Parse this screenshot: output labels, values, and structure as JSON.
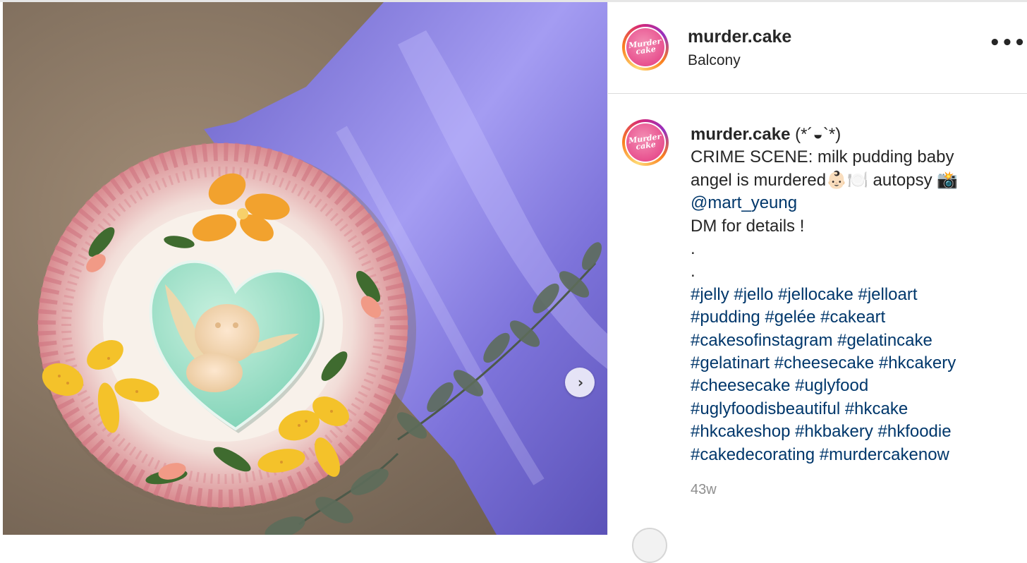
{
  "post": {
    "username": "murder.cake",
    "location": "Balcony",
    "avatar_text": "Murder cake",
    "more_label": "•••"
  },
  "caption": {
    "username": "murder.cake",
    "lines": [
      "(*´◒`*)",
      "CRIME SCENE: milk pudding baby",
      "angel is murdered👶🏻🍽️ autopsy 📸",
      "@mart_yeung",
      "DM for details !",
      ".",
      ".",
      "#jelly #jello #jellocake #jelloart",
      "#pudding #gelée #cakeart",
      "#cakesofinstagram #gelatincake",
      "#gelatinart #cheesecake #hkcakery",
      "#cheesecake #uglyfood",
      "#uglyfoodisbeautiful #hkcake",
      "#hkcakeshop #hkbakery #hkfoodie",
      "#cakedecorating #murdercakenow"
    ],
    "timestamp": "43w"
  },
  "carousel": {
    "next_label": "›"
  },
  "next_comment": {
    "text": ""
  },
  "colors": {
    "link": "#00376b",
    "muted": "#8e8e8e",
    "text": "#262626",
    "satin": "#8f86e6",
    "jelly": "#9fe3c8"
  }
}
